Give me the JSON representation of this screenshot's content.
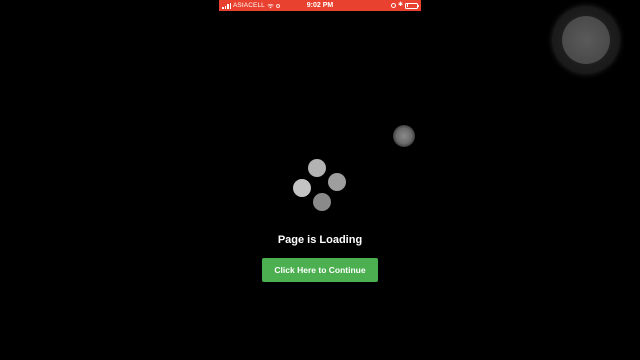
{
  "status_bar": {
    "carrier": "ASIACELL",
    "time": "9:02 PM",
    "bluetooth_symbol": "✱",
    "battery_level": 0.15,
    "background_color": "#e8412f",
    "icons": [
      "signal-icon",
      "wifi-icon",
      "activity-icon",
      "orientation-lock-icon",
      "bluetooth-icon",
      "battery-icon"
    ]
  },
  "main": {
    "loading_text": "Page is Loading",
    "continue_button_label": "Click Here to Continue",
    "button_color": "#4caf50",
    "spinner_colors": [
      "#b3b3b3",
      "#9e9e9e",
      "#8a8a8a",
      "#c4c4c4"
    ]
  },
  "overlay": {
    "assistive_touch_icon": "assistive-touch-icon"
  }
}
